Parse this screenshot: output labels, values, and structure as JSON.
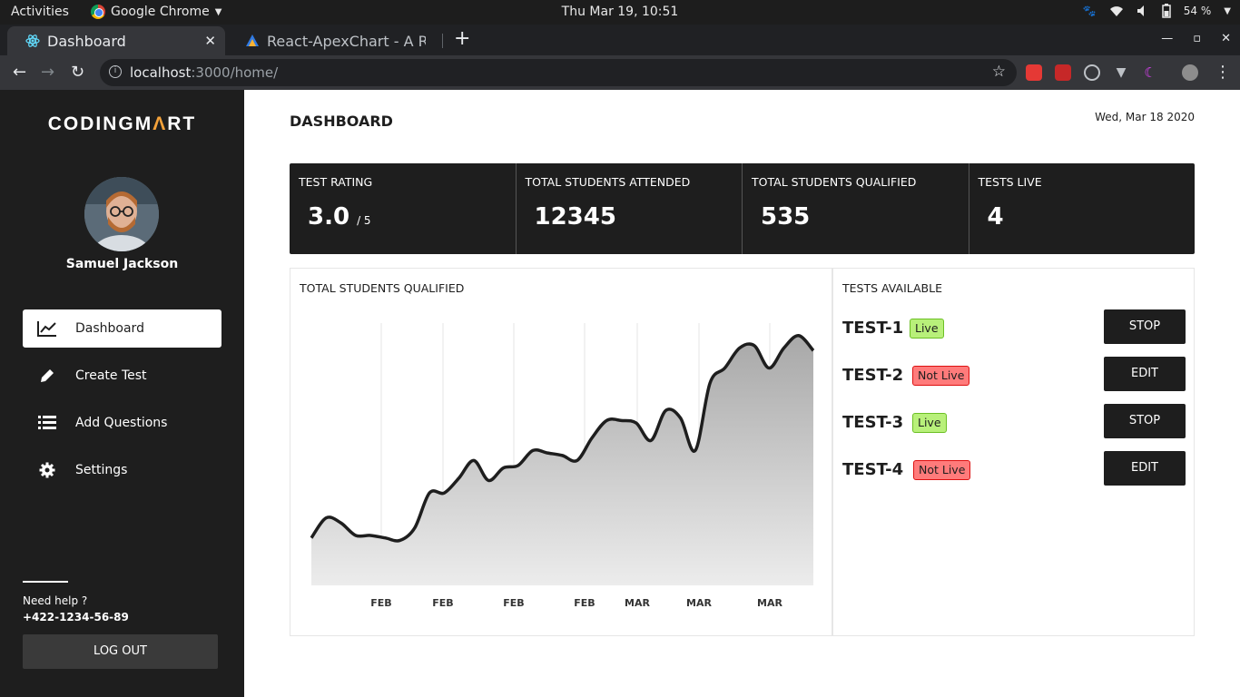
{
  "system_bar": {
    "activities": "Activities",
    "app_name": "Google Chrome",
    "clock": "Thu Mar 19, 10:51",
    "battery": "54 %"
  },
  "browser": {
    "tabs": [
      {
        "title": "Dashboard",
        "active": true
      },
      {
        "title": "React-ApexChart - A React",
        "active": false
      }
    ],
    "url_host": "localhost",
    "url_path": ":3000/home/"
  },
  "sidebar": {
    "brand_part1": "CODINGM",
    "brand_accent": "Λ",
    "brand_part2": "RT",
    "user_name": "Samuel Jackson",
    "nav": [
      {
        "label": "Dashboard",
        "icon": "chart-line-icon",
        "active": true
      },
      {
        "label": "Create Test",
        "icon": "pencil-icon",
        "active": false
      },
      {
        "label": "Add Questions",
        "icon": "list-icon",
        "active": false
      },
      {
        "label": "Settings",
        "icon": "gear-icon",
        "active": false
      }
    ],
    "help_label": "Need help ?",
    "help_phone": "+422-1234-56-89",
    "logout_label": "LOG OUT"
  },
  "header": {
    "title": "DASHBOARD",
    "date": "Wed, Mar 18 2020"
  },
  "stats": [
    {
      "label": "TEST RATING",
      "value": "3.0",
      "suffix": "/ 5"
    },
    {
      "label": "TOTAL STUDENTS ATTENDED",
      "value": "12345",
      "suffix": ""
    },
    {
      "label": "TOTAL STUDENTS QUALIFIED",
      "value": "535",
      "suffix": ""
    },
    {
      "label": "TESTS LIVE",
      "value": "4",
      "suffix": ""
    }
  ],
  "chart_panel": {
    "title": "TOTAL STUDENTS QUALIFIED"
  },
  "chart_data": {
    "type": "area",
    "title": "TOTAL STUDENTS QUALIFIED",
    "x_tick_labels": [
      "FEB",
      "FEB",
      "FEB",
      "FEB",
      "MAR",
      "MAR",
      "MAR"
    ],
    "y_axis_visible": false,
    "grid": "vertical",
    "series": [
      {
        "values": [
          19,
          27,
          25,
          20,
          20,
          19,
          18,
          23,
          37,
          37,
          43,
          50,
          42,
          47,
          48,
          54,
          53,
          52,
          50,
          59,
          66,
          66,
          65,
          58,
          70,
          67,
          54,
          81,
          87,
          95,
          96,
          87,
          95,
          100,
          94
        ]
      }
    ],
    "colors": {
      "line": "#1e1e1e",
      "fill_top": "#a8a8a8",
      "fill_bottom": "#ececec",
      "grid": "#e6e6e6"
    }
  },
  "tests_panel": {
    "title": "TESTS AVAILABLE",
    "tests": [
      {
        "name": "TEST-1",
        "status": "Live",
        "action": "STOP"
      },
      {
        "name": "TEST-2",
        "status": "Not Live",
        "action": "EDIT"
      },
      {
        "name": "TEST-3",
        "status": "Live",
        "action": "STOP"
      },
      {
        "name": "TEST-4",
        "status": "Not Live",
        "action": "EDIT"
      }
    ]
  }
}
